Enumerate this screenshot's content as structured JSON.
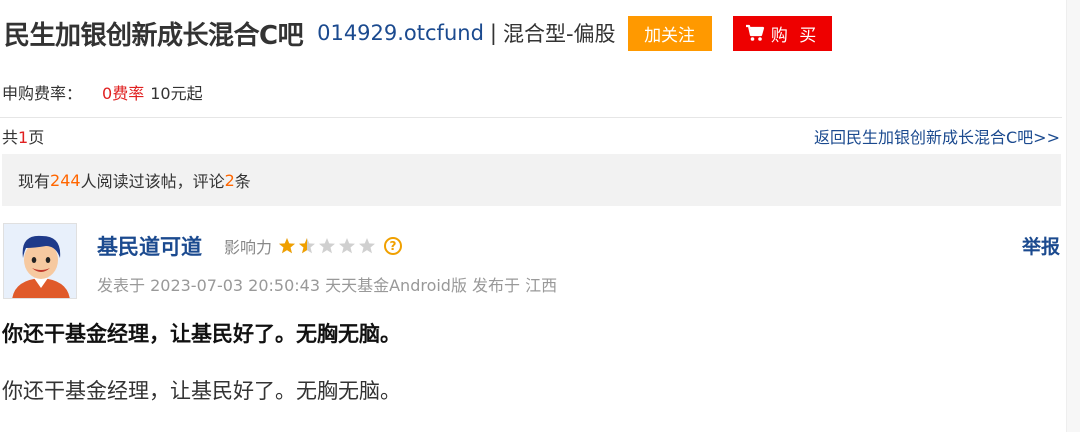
{
  "header": {
    "bar_title": "民生加银创新成长混合C吧",
    "fund_code": "014929.otcfund",
    "separator": "|",
    "fund_type": "混合型-偏股",
    "follow_label": "加关注",
    "buy_label": "购 买"
  },
  "fee": {
    "label": "申购费率：",
    "rate": "0费率",
    "minimum": "10元起"
  },
  "pager": {
    "prefix": "共",
    "count": "1",
    "suffix": "页",
    "back_link": "返回民生加银创新成长混合C吧>>"
  },
  "stats": {
    "prefix": "现有",
    "readers": "244",
    "middle": "人阅读过该帖，评论",
    "comments": "2",
    "suffix": "条"
  },
  "post": {
    "username": "基民道可道",
    "influence_label": "影响力",
    "influence_stars": 1.5,
    "influence_max": 5,
    "report_label": "举报",
    "meta": "发表于 2023-07-03 20:50:43 天天基金Android版 发布于 江西",
    "title": "你还干基金经理，让基民好了。无胸无脑。",
    "body": "你还干基金经理，让基民好了。无胸无脑。"
  },
  "colors": {
    "link_blue": "#1b4a8f",
    "follow_orange": "#ff9900",
    "buy_red": "#ee0000",
    "highlight_red": "#e02020",
    "highlight_orange": "#ff6600",
    "star_gold": "#f0a000",
    "star_empty": "#d0d0d0"
  }
}
